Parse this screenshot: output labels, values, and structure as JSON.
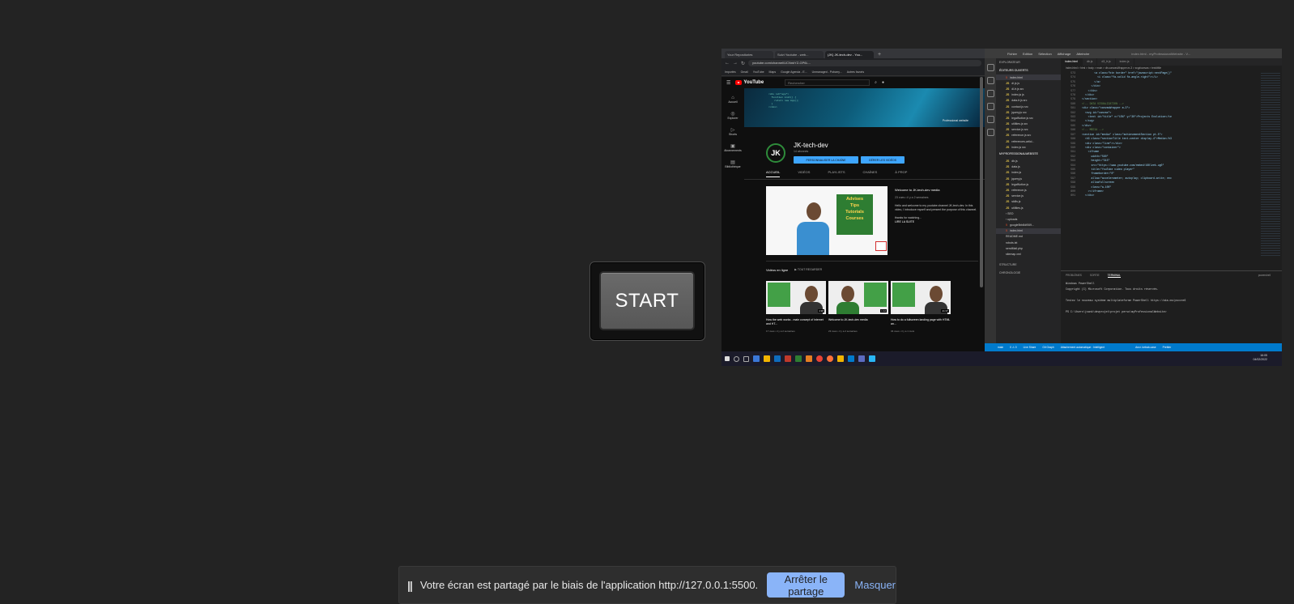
{
  "start_button": {
    "label": "START"
  },
  "browser": {
    "tabs": [
      "Your Repositories",
      "Suivi Youtube - web...",
      "(JK) JK-tech-dev - You..."
    ],
    "url": "youtube.com/channel/UCNnkYZ-GP6L...",
    "bookmarks": [
      "Importés",
      "Gmail",
      "YouTube",
      "Maps",
      "Google Agenda - E...",
      "Unmanaged - Pobarry...",
      "Autres favoris"
    ]
  },
  "youtube": {
    "search_placeholder": "Rechercher",
    "logo_text": "YouTube",
    "sidebar": [
      "Accueil",
      "Explorer",
      "Shorts",
      "Abonnements",
      "Bibliothèque"
    ],
    "banner_tag": "Professional website",
    "avatar_text": "JK",
    "channel_name": "JK-tech-dev",
    "subscribers": "14 abonnés",
    "btn_customize": "PERSONNALISER LA CHAÎNE",
    "btn_manage": "GÉRER LES VIDÉOS",
    "tabs": [
      "ACCUEIL",
      "VIDÉOS",
      "PLAYLISTS",
      "CHAÎNES",
      "À PROP"
    ],
    "featured": {
      "board_lines": [
        "Advises",
        "Tips",
        "Tutorials",
        "Courses"
      ],
      "title": "Welcome to JK-tech-dev media",
      "meta": "23 vues • il y a 2 semaines",
      "desc": "Hello and welcome to my youtube channel JK-tech-dev. In this video, I introduce myself and present the purpose of this channel.",
      "thanks": "thanks for watching...",
      "more": "LIRE LA SUITE"
    },
    "videos_header": "Vidéos en ligne",
    "play_all": "TOUT REGARDER",
    "videos": [
      {
        "title": "How the web works - main concept of internet and HT...",
        "meta": "17 vues • il y a 2 semaines",
        "duration": "4:38"
      },
      {
        "title": "Welcome to JK-tech-dev media",
        "meta": "23 vues • il y a 2 semaines",
        "duration": "1:12"
      },
      {
        "title": "How to do a fullscreen landing page with HTML an...",
        "meta": "34 vues • il y a 1 mois",
        "duration": "21:37"
      }
    ]
  },
  "vscode": {
    "menu": [
      "Fichier",
      "Edition",
      "Sélection",
      "Affichage",
      "Atteindre"
    ],
    "title": "index.html - myProfessionalWebsite - V...",
    "explorer_header": "EXPLORATEUR",
    "open_editors": "ÉDITEURS OUVERTS",
    "open_files": [
      "index.html",
      "dl.js js",
      "dl-fr.js src",
      "index.js js",
      "data-fr.js src",
      "contact.js src",
      "jquery.js src",
      "legalNotice.js src",
      "utilities.js src",
      "service.js src",
      "reference.js src",
      "references-articl...",
      "index.js src"
    ],
    "project": "MYPROFESSIONALWEBSITE",
    "project_files": [
      "db.js",
      "data.js",
      "index.js",
      "jquery.js",
      "legalNotice.js",
      "reference.js",
      "service.js",
      "skills.js",
      "utilities.js",
      "SEO",
      "uploads",
      "google5bb8df069...",
      "index.html",
      "README.md",
      "robots.txt",
      "sendMail.php",
      "sitemap.xml"
    ],
    "outline": [
      "STRUCTURE",
      "CHRONOLOGIE"
    ],
    "editor_tabs": [
      "index.html",
      "db.js",
      "d3_fr.js",
      "index.js"
    ],
    "breadcrumb": "index.html > html > body > main > div.canvasWrapper.m-3 > svg#canvas > text#title",
    "code": [
      {
        "n": "573",
        "t": "        <a class=\"btn border\" href=\"javascript:nextPage()\""
      },
      {
        "n": "574",
        "t": "          <i class=\"fa-solid fa-angle-right\"></i>"
      },
      {
        "n": "575",
        "t": "        </a>"
      },
      {
        "n": "576",
        "t": "      </div>"
      },
      {
        "n": "577",
        "t": "    </div>"
      },
      {
        "n": "578",
        "t": "  </div>"
      },
      {
        "n": "579",
        "t": "</section>"
      },
      {
        "n": "580",
        "t": "<!-- DATA VISUALIZATION -->"
      },
      {
        "n": "581",
        "t": "<div class=\"canvasWrapper m-3\">"
      },
      {
        "n": "582",
        "t": "  <svg id=\"canvas\">"
      },
      {
        "n": "583",
        "t": "    <text id=\"title\" x=\"15%\" y=\"30\">Projects Evolution</te"
      },
      {
        "n": "584",
        "t": "  </svg>"
      },
      {
        "n": "585",
        "t": "</div>"
      },
      {
        "n": "586",
        "t": "<!-- MEDIA -->"
      },
      {
        "n": "587",
        "t": "<section id=\"media\" class=\"achievementSection pt-5\">"
      },
      {
        "n": "588",
        "t": "  <h3 class=\"sectionTitle text-center display-4\">Media</h3"
      },
      {
        "n": "589",
        "t": "  <div class=\"line\"></div>"
      },
      {
        "n": "590",
        "t": "  <div class=\"container\">"
      },
      {
        "n": "591",
        "t": "    <iframe"
      },
      {
        "n": "592",
        "t": "      width=\"560\""
      },
      {
        "n": "593",
        "t": "      height=\"315\""
      },
      {
        "n": "594",
        "t": "      src=\"https://www.youtube.com/embed/16Klzek-ug0\""
      },
      {
        "n": "595",
        "t": "      title=\"YouTube video player\""
      },
      {
        "n": "596",
        "t": "      frameborder=\"0\""
      },
      {
        "n": "597",
        "t": "      allow=\"accelerometer; autoplay; clipboard-write; enc"
      },
      {
        "n": "598",
        "t": "      allowfullscreen"
      },
      {
        "n": "599",
        "t": "      class=\"w-100\""
      },
      {
        "n": "600",
        "t": "    ></iframe>"
      },
      {
        "n": "601",
        "t": "  </div>"
      }
    ],
    "panel_tabs": [
      "PROBLÈMES",
      "SORTIE",
      "TERMINAL"
    ],
    "terminal_label": "powershell",
    "terminal": [
      "Windows PowerShell",
      "Copyright (C) Microsoft Corporation. Tous droits réservés.",
      "",
      "Testez le nouveau système multiplateforme PowerShell https://aka.ms/pscore6",
      "",
      "PS C:\\Users\\jsank\\devprojet\\projet perso\\myProfessionalWebsite>"
    ],
    "status": [
      "main",
      "0 ⚠ 0",
      "Live Share",
      "Git Graph",
      "Attachement automatique : Intelligent",
      "Ancr. kebab-case",
      "Prettier"
    ]
  },
  "taskbar": {
    "time": "16:05",
    "date": "04/02/2022"
  },
  "share_bar": {
    "message": "Votre écran est partagé par le biais de l'application http://127.0.0.1:5500.",
    "stop_label": "Arrêter le partage",
    "hide_label": "Masquer"
  }
}
